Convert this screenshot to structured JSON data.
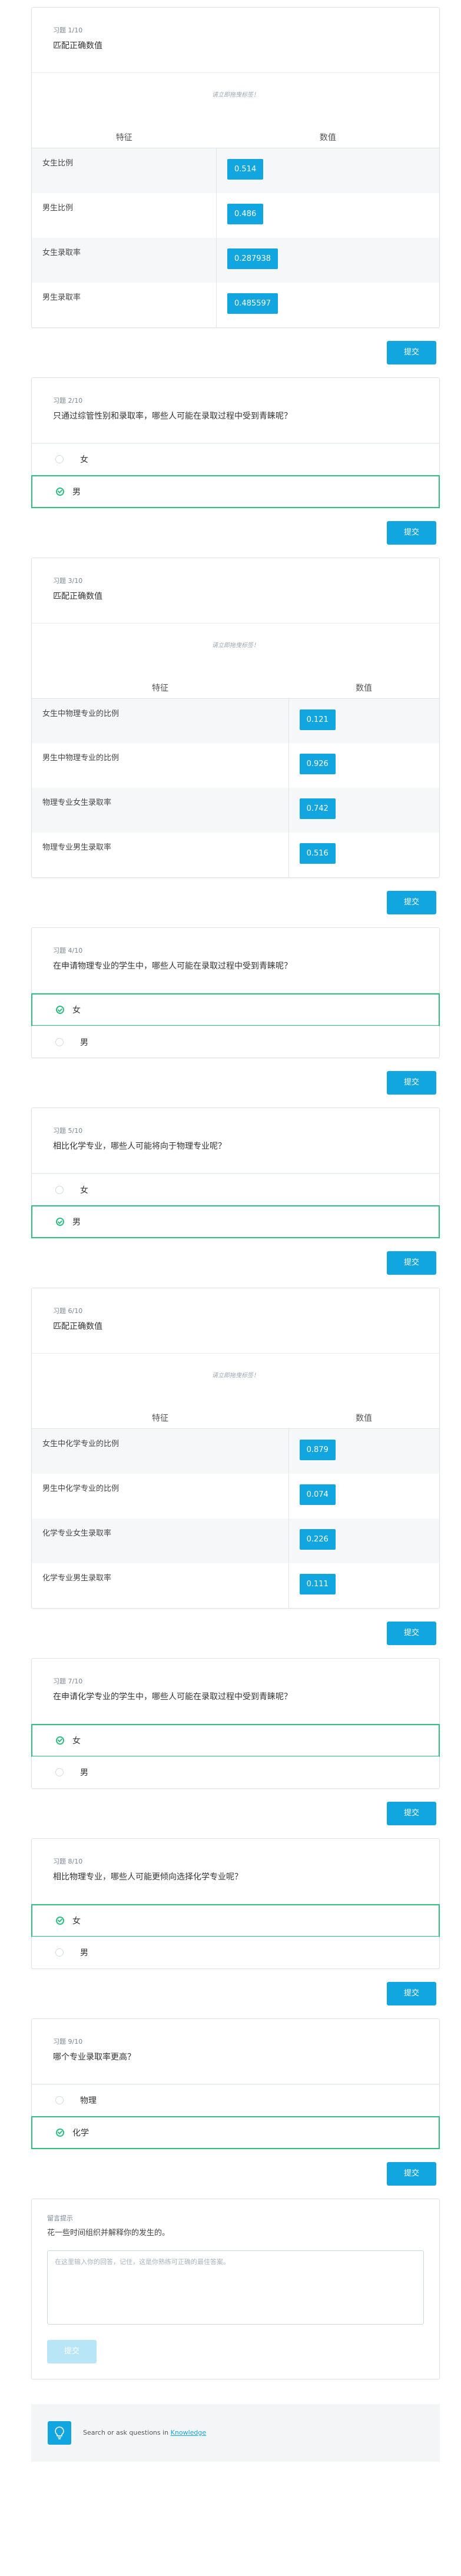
{
  "common": {
    "hint": "请立即拖曳标签！",
    "col_feature": "特征",
    "col_value": "数值",
    "submit_label": "提交"
  },
  "q1": {
    "num": "习题 1/10",
    "title": "匹配正确数值",
    "rows": [
      {
        "label": "女生比例",
        "value": "0.514"
      },
      {
        "label": "男生比例",
        "value": "0.486"
      },
      {
        "label": "女生录取率",
        "value": "0.287938"
      },
      {
        "label": "男生录取率",
        "value": "0.485597"
      }
    ]
  },
  "q2": {
    "num": "习题 2/10",
    "title": "只通过综管性别和录取率，哪些人可能在录取过程中受到青睐呢？",
    "options": [
      "女",
      "男"
    ],
    "selected": 1
  },
  "q3": {
    "num": "习题 3/10",
    "title": "匹配正确数值",
    "rows": [
      {
        "label": "女生中物理专业的比例",
        "value": "0.121"
      },
      {
        "label": "男生中物理专业的比例",
        "value": "0.926"
      },
      {
        "label": "物理专业女生录取率",
        "value": "0.742"
      },
      {
        "label": "物理专业男生录取率",
        "value": "0.516"
      }
    ]
  },
  "q4": {
    "num": "习题 4/10",
    "title": "在申请物理专业的学生中，哪些人可能在录取过程中受到青睐呢？",
    "options": [
      "女",
      "男"
    ],
    "selected": 0
  },
  "q5": {
    "num": "习题 5/10",
    "title": "相比化学专业，哪些人可能将向于物理专业呢？",
    "options": [
      "女",
      "男"
    ],
    "selected": 1
  },
  "q6": {
    "num": "习题 6/10",
    "title": "匹配正确数值",
    "rows": [
      {
        "label": "女生中化学专业的比例",
        "value": "0.879"
      },
      {
        "label": "男生中化学专业的比例",
        "value": "0.074"
      },
      {
        "label": "化学专业女生录取率",
        "value": "0.226"
      },
      {
        "label": "化学专业男生录取率",
        "value": "0.111"
      }
    ]
  },
  "q7": {
    "num": "习题 7/10",
    "title": "在申请化学专业的学生中，哪些人可能在录取过程中受到青睐呢？",
    "options": [
      "女",
      "男"
    ],
    "selected": 0
  },
  "q8": {
    "num": "习题 8/10",
    "title": "相比物理专业，哪些人可能更倾向选择化学专业呢？",
    "options": [
      "女",
      "男"
    ],
    "selected": 0
  },
  "q9": {
    "num": "习题 9/10",
    "title": "哪个专业录取率更高？",
    "options": [
      "物理",
      "化学"
    ],
    "selected": 1
  },
  "feedback": {
    "label": "留言提示",
    "question": "花一些时间组织并解释你的发生的。",
    "placeholder": "在这里输入你的回答，记住，这是你熟练可正确的最佳答案。",
    "submit_label": "提交"
  },
  "knowledge": {
    "text": "Search or ask questions in ",
    "link": "Knowledge"
  }
}
